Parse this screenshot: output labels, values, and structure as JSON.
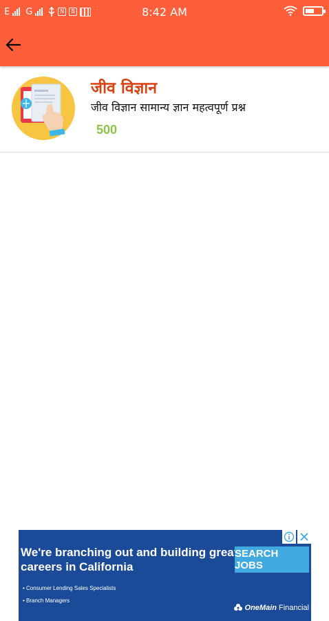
{
  "status_bar": {
    "network_1": "E",
    "network_2": "G",
    "time": "8:42 AM",
    "battery_level": 0.55,
    "icons": [
      "signal-icon",
      "usb-icon",
      "notification-icon",
      "gallery-icon",
      "film-icon",
      "wifi-icon",
      "battery-icon"
    ]
  },
  "app_bar": {
    "back_icon": "arrow-left-icon"
  },
  "item": {
    "title": "जीव विज्ञान",
    "subtitle": "जीव विज्ञान सामान्य ज्ञान महत्वपूर्ण प्रश्न",
    "count": "500",
    "image": "hand-touch-tablet-illustration"
  },
  "ad": {
    "headline": "We're branching out and building great careers in California",
    "cta": "SEARCH JOBS",
    "bullets": [
      "Consumer Lending Sales Specialists",
      "Branch Managers"
    ],
    "brand_strong": "OneMain",
    "brand_light": "Financial",
    "info_icon": "info-icon",
    "close_icon": "close-icon"
  },
  "colors": {
    "primary": "#FF5E3A",
    "title": "#D84315",
    "count": "#8BC34A",
    "ad_bg": "#1B4B98",
    "ad_cta": "#3FA9E0"
  }
}
